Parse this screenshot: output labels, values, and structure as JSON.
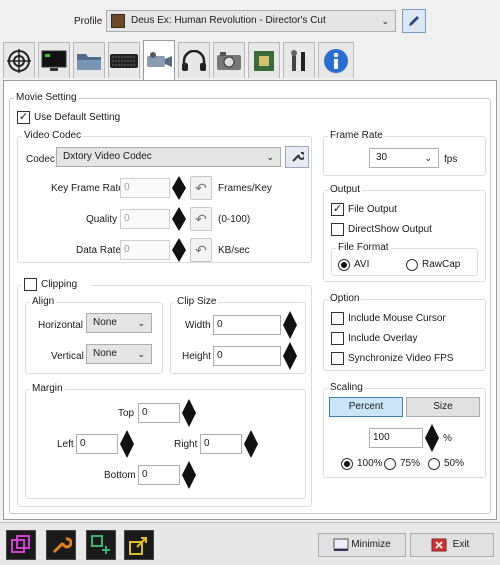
{
  "profile": {
    "label": "Profile",
    "value": "Deus Ex: Human Revolution - Director's Cut"
  },
  "tabs": [
    "target-icon",
    "monitor-icon",
    "folder-icon",
    "keyboard-icon",
    "camcorder-icon",
    "headphones-icon",
    "camera-icon",
    "chip-icon",
    "tools-icon",
    "info-icon"
  ],
  "movie": {
    "title": "Movie Setting",
    "use_default": "Use Default Setting",
    "codec_group": "Video Codec",
    "codec_label": "Codec",
    "codec_value": "Dxtory Video Codec",
    "keyframe": {
      "label": "Key Frame Rate",
      "value": "0",
      "unit": "Frames/Key"
    },
    "quality": {
      "label": "Quality",
      "value": "0",
      "unit": "(0-100)"
    },
    "datarate": {
      "label": "Data Rate",
      "value": "0",
      "unit": "KB/sec"
    }
  },
  "clipping": {
    "label": "Clipping",
    "align": {
      "title": "Align",
      "horizontal_label": "Horizontal",
      "horizontal_value": "None",
      "vertical_label": "Vertical",
      "vertical_value": "None"
    },
    "clipsize": {
      "title": "Clip Size",
      "width_label": "Width",
      "width_value": "0",
      "height_label": "Height",
      "height_value": "0"
    },
    "margin": {
      "title": "Margin",
      "top_label": "Top",
      "top_value": "0",
      "left_label": "Left",
      "left_value": "0",
      "right_label": "Right",
      "right_value": "0",
      "bottom_label": "Bottom",
      "bottom_value": "0"
    }
  },
  "framerate": {
    "title": "Frame Rate",
    "value": "30",
    "unit": "fps"
  },
  "output": {
    "title": "Output",
    "file_output": "File Output",
    "directshow": "DirectShow Output",
    "format_title": "File Format",
    "avi": "AVI",
    "rawcap": "RawCap"
  },
  "option": {
    "title": "Option",
    "mouse": "Include Mouse Cursor",
    "overlay": "Include Overlay",
    "sync": "Synchronize Video FPS"
  },
  "scaling": {
    "title": "Scaling",
    "percent": "Percent",
    "size": "Size",
    "value": "100",
    "unit": "%",
    "r100": "100%",
    "r75": "75%",
    "r50": "50%"
  },
  "bottom": {
    "minimize": "Minimize",
    "exit": "Exit"
  }
}
